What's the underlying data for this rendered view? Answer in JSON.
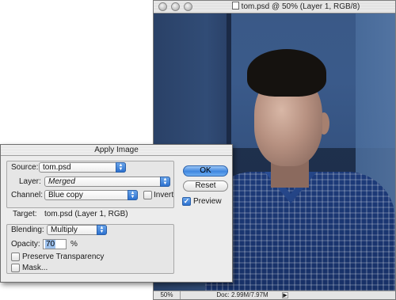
{
  "document": {
    "title": "tom.psd @ 50% (Layer 1, RGB/8)",
    "zoom": "50%",
    "doc_size": "Doc: 2.99M/7.97M",
    "status_arrow": "▶"
  },
  "dialog": {
    "title": "Apply Image",
    "source": {
      "label": "Source:",
      "value": "tom.psd"
    },
    "layer": {
      "label": "Layer:",
      "value": "Merged"
    },
    "channel": {
      "label": "Channel:",
      "value": "Blue copy"
    },
    "invert": {
      "label": "Invert",
      "checked": false
    },
    "target": {
      "label": "Target:",
      "value": "tom.psd (Layer 1, RGB)"
    },
    "blending": {
      "label": "Blending:",
      "value": "Multiply"
    },
    "opacity": {
      "label": "Opacity:",
      "value": "70",
      "unit": "%"
    },
    "preserve_transparency": {
      "label": "Preserve Transparency",
      "checked": false
    },
    "mask": {
      "label": "Mask...",
      "checked": false
    },
    "buttons": {
      "ok": "OK",
      "reset": "Reset"
    },
    "preview": {
      "label": "Preview",
      "checked": true
    }
  },
  "colors": {
    "accent": "#3f86df",
    "canvas_blue": "#3a5a8a"
  }
}
